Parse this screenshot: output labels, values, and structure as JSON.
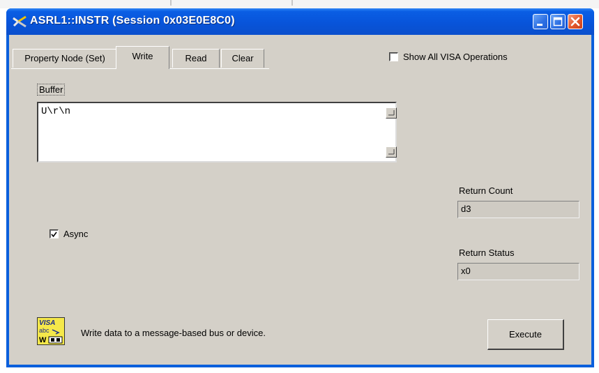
{
  "window": {
    "title": "ASRL1::INSTR (Session 0x03E0E8C0)"
  },
  "tabs": [
    {
      "label": "Property Node (Set)",
      "active": false
    },
    {
      "label": "Write",
      "active": true
    },
    {
      "label": "Read",
      "active": false
    },
    {
      "label": "Clear",
      "active": false
    }
  ],
  "options": {
    "show_all_label": "Show All VISA Operations",
    "show_all_checked": false
  },
  "write_panel": {
    "buffer_label": "Buffer",
    "buffer_value": "U\\r\\n",
    "async_label": "Async",
    "async_checked": true,
    "return_count_label": "Return Count",
    "return_count_prefix": "d",
    "return_count_value": "3",
    "return_status_label": "Return Status",
    "return_status_prefix": "x",
    "return_status_value": "0",
    "description": "Write data to a message-based bus or device.",
    "execute_label": "Execute"
  },
  "visa_icon": {
    "name": "visa-write-icon",
    "line1": "VISA",
    "line2": "abc",
    "line3": "W"
  },
  "colors": {
    "titlebar": "#0a5fdc",
    "client": "#d4d0c8",
    "close_button": "#e2572c",
    "visa_icon_bg": "#f5e84a"
  }
}
